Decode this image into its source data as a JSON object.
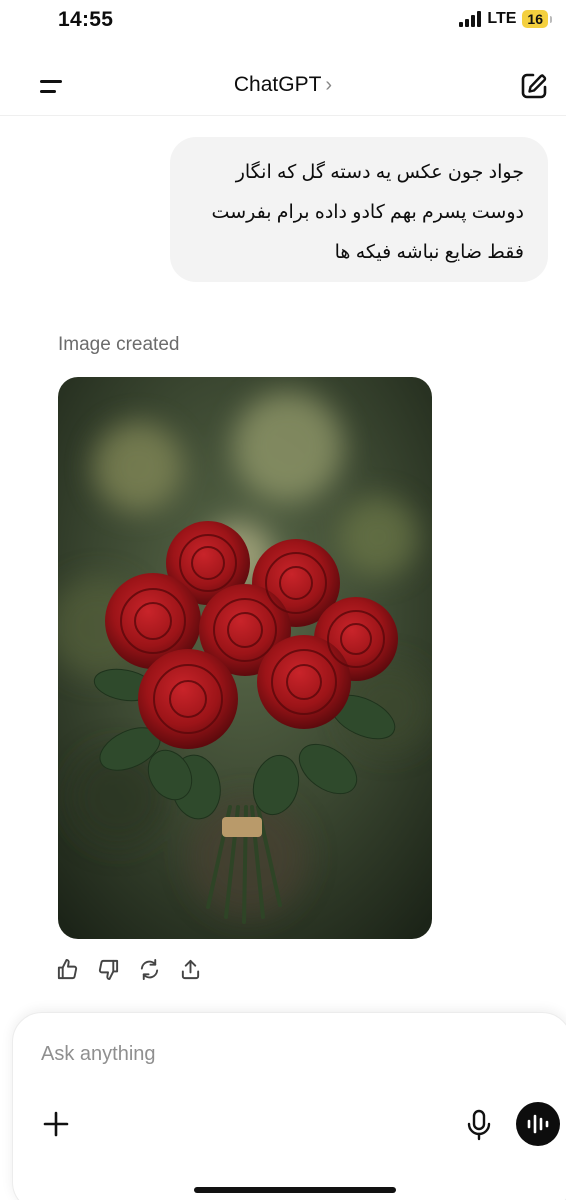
{
  "status_bar": {
    "time": "14:55",
    "network": "LTE",
    "battery": "16"
  },
  "header": {
    "title": "ChatGPT",
    "chevron": "›"
  },
  "icons": {
    "menu": "menu-icon",
    "new_chat": "new-chat-icon",
    "thumbs_up": "thumbs-up-icon",
    "thumbs_down": "thumbs-down-icon",
    "regenerate": "regenerate-icon",
    "share": "share-icon",
    "plus": "plus-icon",
    "mic": "microphone-icon",
    "voice": "voice-mode-icon"
  },
  "conversation": {
    "user_message": {
      "lines": [
        "جواد جون عکس یه دسته گل که انگار",
        "دوست پسرم بهم کادو داده برام بفرست",
        "فقط ضایع نباشه فیکه ها"
      ]
    },
    "assistant": {
      "status": "Image created",
      "image": "red-roses-bouquet"
    }
  },
  "composer": {
    "placeholder": "Ask anything",
    "value": ""
  },
  "colors": {
    "bubble": "#f3f3f3",
    "rose": "#9c1418",
    "leaf": "#2f4a2c",
    "battery": "#f4d03f"
  }
}
